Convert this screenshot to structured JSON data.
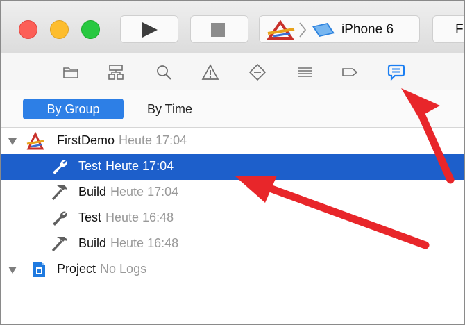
{
  "toolbar": {
    "window_controls": [
      "close",
      "minimize",
      "zoom"
    ],
    "run_icon": "play-icon",
    "stop_icon": "stop-icon",
    "scheme": {
      "project_icon": "app-icon",
      "device_icon": "iphone-icon",
      "device_label": "iPhone 6"
    },
    "destination_label": "Fir"
  },
  "navigator_tabs": [
    {
      "name": "project-navigator",
      "icon": "folder-icon"
    },
    {
      "name": "symbol-navigator",
      "icon": "hierarchy-icon"
    },
    {
      "name": "find-navigator",
      "icon": "magnifier-icon"
    },
    {
      "name": "issue-navigator",
      "icon": "warning-icon"
    },
    {
      "name": "test-navigator",
      "icon": "diamond-minus-icon"
    },
    {
      "name": "debug-navigator",
      "icon": "list-icon"
    },
    {
      "name": "breakpoint-navigator",
      "icon": "breakpoint-tag-icon"
    },
    {
      "name": "report-navigator",
      "icon": "speech-bubble-icon",
      "selected": true
    }
  ],
  "filter": {
    "by_group": "By Group",
    "by_time": "By Time",
    "active": "by_group"
  },
  "tree": {
    "group1": {
      "name": "FirstDemo",
      "time": "Heute 17:04",
      "icon": "app-icon"
    },
    "items": [
      {
        "name": "Test",
        "time": "Heute 17:04",
        "icon": "wrench-icon",
        "selected": true
      },
      {
        "name": "Build",
        "time": "Heute 17:04",
        "icon": "hammer-icon",
        "selected": false
      },
      {
        "name": "Test",
        "time": "Heute 16:48",
        "icon": "wrench-icon",
        "selected": false
      },
      {
        "name": "Build",
        "time": "Heute 16:48",
        "icon": "hammer-icon",
        "selected": false
      }
    ],
    "group2": {
      "name": "Project",
      "time": "No Logs",
      "icon": "project-doc-icon"
    }
  },
  "colors": {
    "selection": "#1d5fcb",
    "segment_active": "#2d7fe6",
    "accent_icon": "#1a7ef2",
    "annotation_arrow": "#e8262a"
  }
}
